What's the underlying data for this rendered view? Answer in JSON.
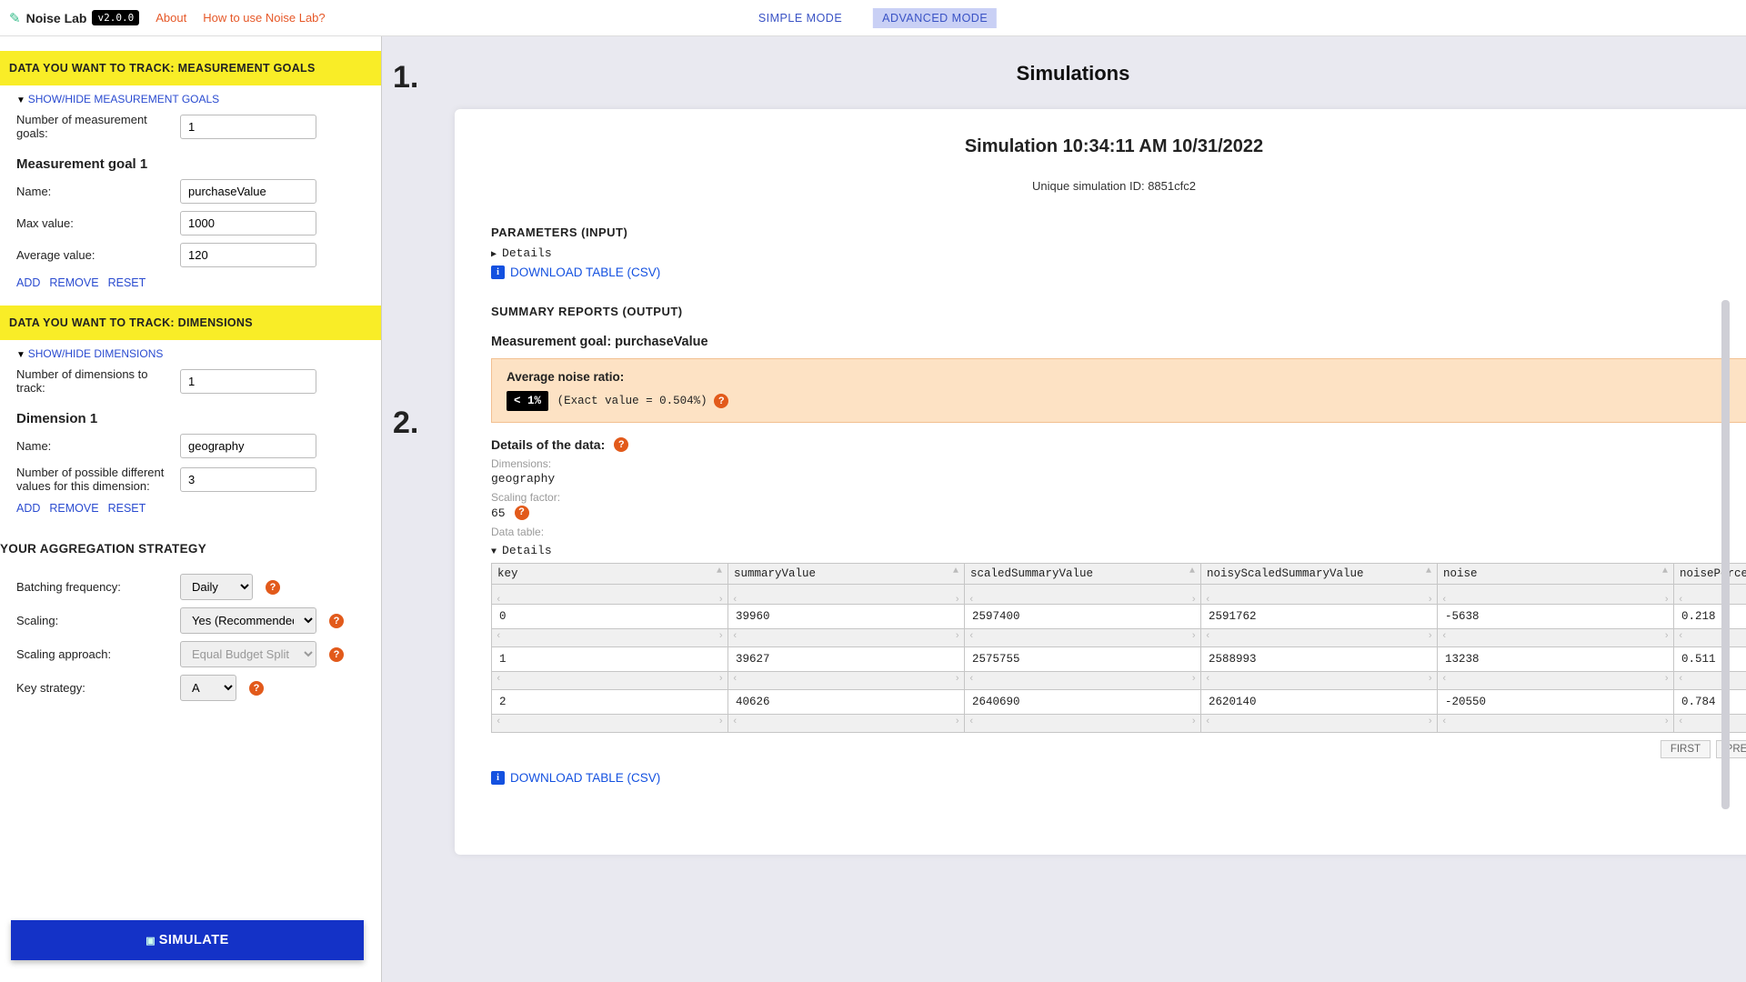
{
  "topbar": {
    "brand": "Noise Lab",
    "version": "v2.0.0",
    "about": "About",
    "howto": "How to use Noise Lab?",
    "simple": "SIMPLE MODE",
    "advanced": "ADVANCED MODE"
  },
  "annotations": {
    "one": "1.",
    "two": "2."
  },
  "sidebar": {
    "sec1_title": "DATA YOU WANT TO TRACK: MEASUREMENT GOALS",
    "toggle1": "SHOW/HIDE MEASUREMENT GOALS",
    "num_goals_label": "Number of measurement goals:",
    "num_goals_value": "1",
    "mg1_title": "Measurement goal 1",
    "mg1_name_label": "Name:",
    "mg1_name_value": "purchaseValue",
    "mg1_max_label": "Max value:",
    "mg1_max_value": "1000",
    "mg1_avg_label": "Average value:",
    "mg1_avg_value": "120",
    "add": "ADD",
    "remove": "REMOVE",
    "reset": "RESET",
    "sec2_title": "DATA YOU WANT TO TRACK: DIMENSIONS",
    "toggle2": "SHOW/HIDE DIMENSIONS",
    "num_dims_label": "Number of dimensions to track:",
    "num_dims_value": "1",
    "dim1_title": "Dimension 1",
    "dim1_name_label": "Name:",
    "dim1_name_value": "geography",
    "dim1_count_label": "Number of possible different values for this dimension:",
    "dim1_count_value": "3",
    "sec3_title": "YOUR AGGREGATION STRATEGY",
    "batch_label": "Batching frequency:",
    "batch_value": "Daily",
    "scaling_label": "Scaling:",
    "scaling_value": "Yes (Recommended)",
    "approach_label": "Scaling approach:",
    "approach_value": "Equal Budget Split",
    "key_label": "Key strategy:",
    "key_value": "A",
    "simulate": "SIMULATE"
  },
  "main": {
    "page_title": "Simulations",
    "sim_title": "Simulation 10:34:11 AM 10/31/2022",
    "sim_id": "Unique simulation ID: 8851cfc2",
    "params_label": "PARAMETERS (INPUT)",
    "details": "Details",
    "download": "DOWNLOAD TABLE (CSV)",
    "summary_label": "SUMMARY REPORTS (OUTPUT)",
    "mg_title": "Measurement goal: purchaseValue",
    "noise": {
      "label": "Average noise ratio:",
      "chip": "< 1%",
      "exact": "(Exact value = 0.504%)"
    },
    "details_data": "Details of the data:",
    "dims_label": "Dimensions:",
    "dims_value": "geography",
    "sf_label": "Scaling factor:",
    "sf_value": "65",
    "dt_label": "Data table:",
    "table": {
      "headers": [
        "key",
        "summaryValue",
        "scaledSummaryValue",
        "noisyScaledSummaryValue",
        "noise",
        "noisePercentag"
      ],
      "rows": [
        {
          "key": "0",
          "summaryValue": "39960",
          "scaledSummaryValue": "2597400",
          "noisyScaledSummaryValue": "2591762",
          "noise": "-5638",
          "noisePercentage": "0.218"
        },
        {
          "key": "1",
          "summaryValue": "39627",
          "scaledSummaryValue": "2575755",
          "noisyScaledSummaryValue": "2588993",
          "noise": "13238",
          "noisePercentage": "0.511"
        },
        {
          "key": "2",
          "summaryValue": "40626",
          "scaledSummaryValue": "2640690",
          "noisyScaledSummaryValue": "2620140",
          "noise": "-20550",
          "noisePercentage": "0.784"
        }
      ]
    },
    "pager": {
      "first": "FIRST",
      "prev": "PREV"
    }
  }
}
